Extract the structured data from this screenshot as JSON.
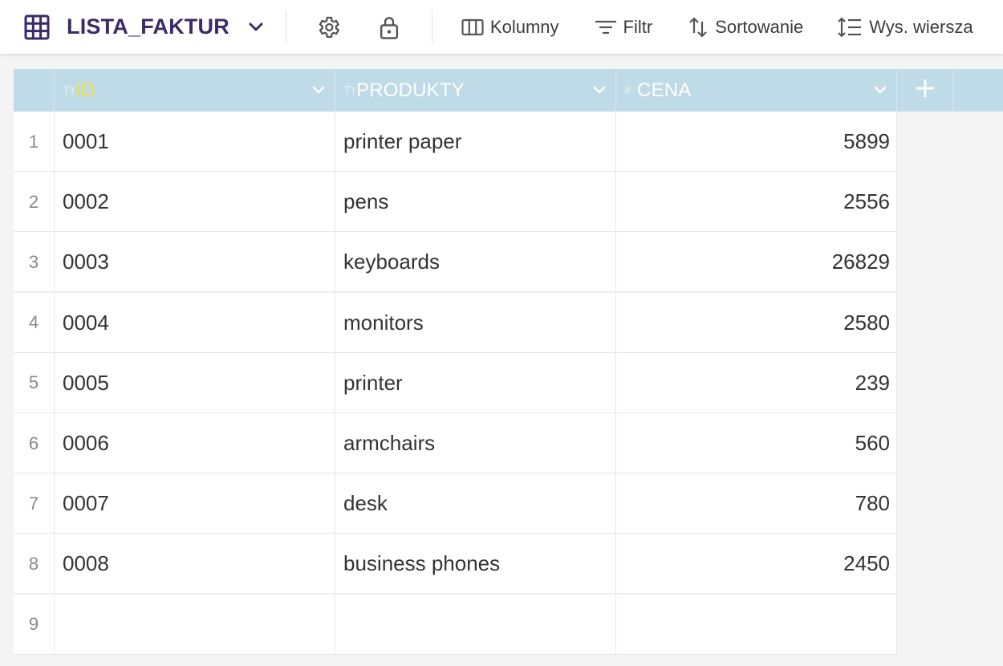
{
  "toolbar": {
    "table_name": "LISTA_FAKTUR",
    "columns_label": "Kolumny",
    "filter_label": "Filtr",
    "sort_label": "Sortowanie",
    "row_height_label": "Wys. wiersza"
  },
  "colors": {
    "title": "#3d2a68",
    "header_bg": "#bfdbe7",
    "id_header_text": "#f2e33a",
    "header_text": "#ffffff"
  },
  "icons": {
    "table": "grid-icon",
    "dropdown": "chevron-down-icon",
    "settings": "gear-icon",
    "lock": "lock-icon",
    "columns": "columns-icon",
    "filter": "filter-icon",
    "sort": "sort-arrows-icon",
    "row_height": "row-height-icon",
    "add_column": "plus-icon"
  },
  "columns": [
    {
      "label": "ID",
      "type_icon": "Tт",
      "type": "text"
    },
    {
      "label": "PRODUKTY",
      "type_icon": "Tт",
      "type": "text"
    },
    {
      "label": "CENA",
      "type_icon": "#",
      "type": "number"
    }
  ],
  "rows": [
    {
      "num": "1",
      "id": "0001",
      "product": "printer paper",
      "price": "5899"
    },
    {
      "num": "2",
      "id": "0002",
      "product": "pens",
      "price": "2556"
    },
    {
      "num": "3",
      "id": "0003",
      "product": "keyboards",
      "price": "26829"
    },
    {
      "num": "4",
      "id": "0004",
      "product": "monitors",
      "price": "2580"
    },
    {
      "num": "5",
      "id": "0005",
      "product": "printer",
      "price": "239"
    },
    {
      "num": "6",
      "id": "0006",
      "product": "armchairs",
      "price": "560"
    },
    {
      "num": "7",
      "id": "0007",
      "product": "desk",
      "price": "780"
    },
    {
      "num": "8",
      "id": "0008",
      "product": "business phones",
      "price": "2450"
    },
    {
      "num": "9",
      "id": "",
      "product": "",
      "price": ""
    }
  ]
}
